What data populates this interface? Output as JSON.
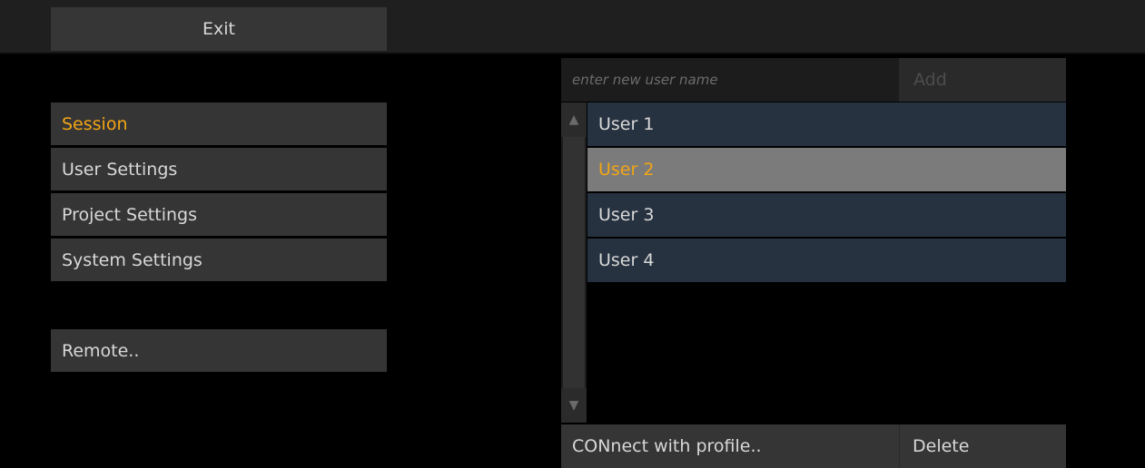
{
  "header": {
    "exit_label": "Exit"
  },
  "menu": {
    "items": [
      {
        "label": "Session",
        "active": true
      },
      {
        "label": "User Settings",
        "active": false
      },
      {
        "label": "Project Settings",
        "active": false
      },
      {
        "label": "System Settings",
        "active": false
      }
    ],
    "remote_label": "Remote.."
  },
  "users_panel": {
    "new_user_placeholder": "enter new user name",
    "new_user_value": "",
    "add_label": "Add",
    "scroll_up_icon": "triangle-up-icon",
    "scroll_down_icon": "triangle-down-icon",
    "users": [
      {
        "name": "User 1",
        "selected": false
      },
      {
        "name": "User 2",
        "selected": true
      },
      {
        "name": "User 3",
        "selected": false
      },
      {
        "name": "User 4",
        "selected": false
      }
    ],
    "connect_label": "CONnect with profile..",
    "delete_label": "Delete"
  },
  "colors": {
    "accent": "#f2a516",
    "row_bg": "#263240",
    "row_selected_bg": "#7b7b7b",
    "button_bg": "#353535"
  }
}
